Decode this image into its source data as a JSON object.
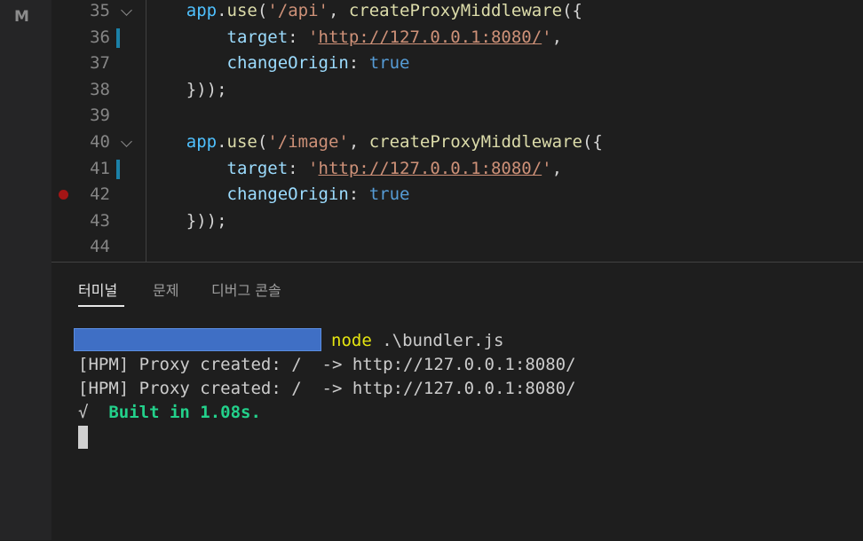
{
  "activity_bar": {
    "scm_badge": "M"
  },
  "editor": {
    "lines": [
      {
        "num": "35",
        "fold": true,
        "mod": false,
        "bp": false,
        "tokens": [
          [
            "punc",
            "    "
          ],
          [
            "var",
            "app"
          ],
          [
            "punc",
            "."
          ],
          [
            "fn",
            "use"
          ],
          [
            "punc",
            "("
          ],
          [
            "str",
            "'/api'"
          ],
          [
            "punc",
            ", "
          ],
          [
            "fn",
            "createProxyMiddleware"
          ],
          [
            "punc",
            "({"
          ]
        ]
      },
      {
        "num": "36",
        "fold": false,
        "mod": true,
        "bp": false,
        "tokens": [
          [
            "punc",
            "        "
          ],
          [
            "prop",
            "target"
          ],
          [
            "punc",
            ": "
          ],
          [
            "str",
            "'"
          ],
          [
            "url",
            "http://127.0.0.1:8080/"
          ],
          [
            "str",
            "'"
          ],
          [
            "punc",
            ","
          ]
        ]
      },
      {
        "num": "37",
        "fold": false,
        "mod": false,
        "bp": false,
        "tokens": [
          [
            "punc",
            "        "
          ],
          [
            "prop",
            "changeOrigin"
          ],
          [
            "punc",
            ": "
          ],
          [
            "kw",
            "true"
          ]
        ]
      },
      {
        "num": "38",
        "fold": false,
        "mod": false,
        "bp": false,
        "tokens": [
          [
            "punc",
            "    }));"
          ]
        ]
      },
      {
        "num": "39",
        "fold": false,
        "mod": false,
        "bp": false,
        "tokens": []
      },
      {
        "num": "40",
        "fold": true,
        "mod": false,
        "bp": false,
        "tokens": [
          [
            "punc",
            "    "
          ],
          [
            "var",
            "app"
          ],
          [
            "punc",
            "."
          ],
          [
            "fn",
            "use"
          ],
          [
            "punc",
            "("
          ],
          [
            "str",
            "'/image'"
          ],
          [
            "punc",
            ", "
          ],
          [
            "fn",
            "createProxyMiddleware"
          ],
          [
            "punc",
            "({"
          ]
        ]
      },
      {
        "num": "41",
        "fold": false,
        "mod": true,
        "bp": false,
        "tokens": [
          [
            "punc",
            "        "
          ],
          [
            "prop",
            "target"
          ],
          [
            "punc",
            ": "
          ],
          [
            "str",
            "'"
          ],
          [
            "url",
            "http://127.0.0.1:8080/"
          ],
          [
            "str",
            "'"
          ],
          [
            "punc",
            ","
          ]
        ]
      },
      {
        "num": "42",
        "fold": false,
        "mod": false,
        "bp": true,
        "tokens": [
          [
            "punc",
            "        "
          ],
          [
            "prop",
            "changeOrigin"
          ],
          [
            "punc",
            ": "
          ],
          [
            "kw",
            "true"
          ]
        ]
      },
      {
        "num": "43",
        "fold": false,
        "mod": false,
        "bp": false,
        "tokens": [
          [
            "punc",
            "    }));"
          ]
        ]
      },
      {
        "num": "44",
        "fold": false,
        "mod": false,
        "bp": false,
        "tokens": []
      }
    ]
  },
  "panel": {
    "tabs": {
      "terminal": "터미널",
      "problems": "문제",
      "debug_console": "디버그 콘솔"
    },
    "terminal": {
      "command": "node",
      "command_args": " .\\bundler.js",
      "output": [
        "[HPM] Proxy created: /  -> http://127.0.0.1:8080/",
        "[HPM] Proxy created: /  -> http://127.0.0.1:8080/"
      ],
      "built_check": "√",
      "built_msg": "Built in 1.08s."
    }
  }
}
